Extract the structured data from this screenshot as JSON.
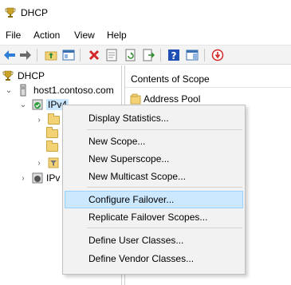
{
  "window": {
    "title": "DHCP",
    "app_icon": "dhcp-trophy-icon"
  },
  "menu": [
    "File",
    "Action",
    "View",
    "Help"
  ],
  "toolbar": {
    "buttons": [
      "back-arrow-icon",
      "forward-arrow-icon",
      "folder-up-icon",
      "show-hide-tree-icon",
      "delete-icon",
      "properties-icon",
      "refresh-icon",
      "export-list-icon",
      "help-icon",
      "show-action-pane-icon",
      "deactivate-icon"
    ]
  },
  "tree": {
    "root": "DHCP",
    "server": "host1.contoso.com",
    "ipv4": "IPv4",
    "ipv6": "IPv"
  },
  "right_pane": {
    "column_header": "Contents of Scope",
    "rows": [
      "Address Pool"
    ]
  },
  "context_menu": {
    "items": [
      "Display Statistics...",
      "New Scope...",
      "New Superscope...",
      "New Multicast Scope...",
      "Configure Failover...",
      "Replicate Failover Scopes...",
      "Define User Classes...",
      "Define Vendor Classes..."
    ],
    "highlighted": "Configure Failover..."
  },
  "colors": {
    "highlight_bg": "#cce8ff",
    "highlight_border": "#99d1ff",
    "help_blue": "#1f4fb5",
    "delete_red": "#d42626"
  }
}
